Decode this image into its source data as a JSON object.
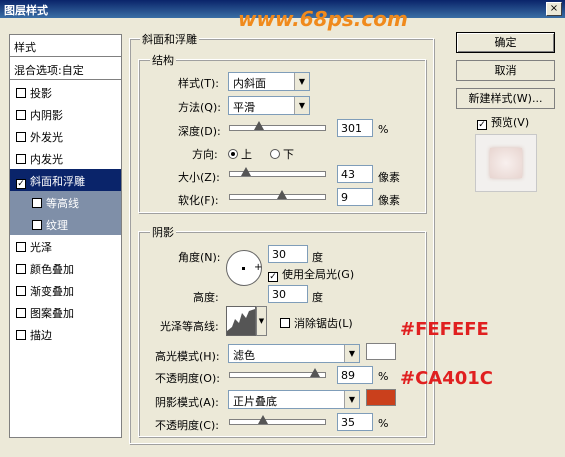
{
  "window": {
    "title": "图层样式",
    "watermark": "www.68ps.com",
    "close_glyph": "×"
  },
  "styles_panel": {
    "header": "样式",
    "blending_options": "混合选项:自定",
    "items": [
      {
        "label": "投影",
        "checked": false
      },
      {
        "label": "内阴影",
        "checked": false
      },
      {
        "label": "外发光",
        "checked": false
      },
      {
        "label": "内发光",
        "checked": false
      },
      {
        "label": "斜面和浮雕",
        "checked": true,
        "selected": true
      },
      {
        "label": "等高线",
        "checked": false,
        "sub": true
      },
      {
        "label": "纹理",
        "checked": false,
        "sub": true
      },
      {
        "label": "光泽",
        "checked": false
      },
      {
        "label": "颜色叠加",
        "checked": false
      },
      {
        "label": "渐变叠加",
        "checked": false
      },
      {
        "label": "图案叠加",
        "checked": false
      },
      {
        "label": "描边",
        "checked": false
      }
    ]
  },
  "bevel": {
    "section_title": "斜面和浮雕",
    "structure_title": "结构",
    "style_label": "样式(T):",
    "style_value": "内斜面",
    "technique_label": "方法(Q):",
    "technique_value": "平滑",
    "depth_label": "深度(D):",
    "depth_value": "301",
    "depth_unit": "%",
    "depth_level": 0.3,
    "direction_label": "方向:",
    "direction_up": "上",
    "direction_down": "下",
    "size_label": "大小(Z):",
    "size_value": "43",
    "size_unit": "像素",
    "size_level": 0.17,
    "soften_label": "软化(F):",
    "soften_value": "9",
    "soften_unit": "像素",
    "soften_level": 0.55
  },
  "shading": {
    "title": "阴影",
    "angle_label": "角度(N):",
    "angle_value": "30",
    "angle_unit": "度",
    "global_light_label": "使用全局光(G)",
    "global_light_checked": true,
    "altitude_label": "高度:",
    "altitude_value": "30",
    "altitude_unit": "度",
    "gloss_label": "光泽等高线:",
    "antialias_label": "消除锯齿(L)",
    "highlight_mode_label": "高光模式(H):",
    "highlight_mode_value": "滤色",
    "highlight_color": "#FEFEFE",
    "highlight_opacity_label": "不透明度(O):",
    "highlight_opacity_value": "89",
    "highlight_opacity_unit": "%",
    "highlight_opacity_level": 0.89,
    "shadow_mode_label": "阴影模式(A):",
    "shadow_mode_value": "正片叠底",
    "shadow_color": "#CA401C",
    "shadow_opacity_label": "不透明度(C):",
    "shadow_opacity_value": "35",
    "shadow_opacity_unit": "%",
    "shadow_opacity_level": 0.35
  },
  "annotations": {
    "highlight_color_text": "#FEFEFE",
    "shadow_color_text": "#CA401C"
  },
  "buttons": {
    "ok": "确定",
    "cancel": "取消",
    "new_style": "新建样式(W)...",
    "preview": "预览(V)",
    "preview_checked": true
  }
}
